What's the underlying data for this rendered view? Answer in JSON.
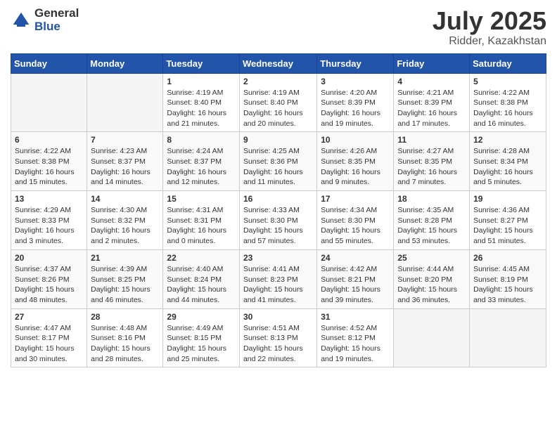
{
  "header": {
    "logo_general": "General",
    "logo_blue": "Blue",
    "title": "July 2025",
    "subtitle": "Ridder, Kazakhstan"
  },
  "weekdays": [
    "Sunday",
    "Monday",
    "Tuesday",
    "Wednesday",
    "Thursday",
    "Friday",
    "Saturday"
  ],
  "weeks": [
    [
      {
        "day": "",
        "info": ""
      },
      {
        "day": "",
        "info": ""
      },
      {
        "day": "1",
        "info": "Sunrise: 4:19 AM\nSunset: 8:40 PM\nDaylight: 16 hours\nand 21 minutes."
      },
      {
        "day": "2",
        "info": "Sunrise: 4:19 AM\nSunset: 8:40 PM\nDaylight: 16 hours\nand 20 minutes."
      },
      {
        "day": "3",
        "info": "Sunrise: 4:20 AM\nSunset: 8:39 PM\nDaylight: 16 hours\nand 19 minutes."
      },
      {
        "day": "4",
        "info": "Sunrise: 4:21 AM\nSunset: 8:39 PM\nDaylight: 16 hours\nand 17 minutes."
      },
      {
        "day": "5",
        "info": "Sunrise: 4:22 AM\nSunset: 8:38 PM\nDaylight: 16 hours\nand 16 minutes."
      }
    ],
    [
      {
        "day": "6",
        "info": "Sunrise: 4:22 AM\nSunset: 8:38 PM\nDaylight: 16 hours\nand 15 minutes."
      },
      {
        "day": "7",
        "info": "Sunrise: 4:23 AM\nSunset: 8:37 PM\nDaylight: 16 hours\nand 14 minutes."
      },
      {
        "day": "8",
        "info": "Sunrise: 4:24 AM\nSunset: 8:37 PM\nDaylight: 16 hours\nand 12 minutes."
      },
      {
        "day": "9",
        "info": "Sunrise: 4:25 AM\nSunset: 8:36 PM\nDaylight: 16 hours\nand 11 minutes."
      },
      {
        "day": "10",
        "info": "Sunrise: 4:26 AM\nSunset: 8:35 PM\nDaylight: 16 hours\nand 9 minutes."
      },
      {
        "day": "11",
        "info": "Sunrise: 4:27 AM\nSunset: 8:35 PM\nDaylight: 16 hours\nand 7 minutes."
      },
      {
        "day": "12",
        "info": "Sunrise: 4:28 AM\nSunset: 8:34 PM\nDaylight: 16 hours\nand 5 minutes."
      }
    ],
    [
      {
        "day": "13",
        "info": "Sunrise: 4:29 AM\nSunset: 8:33 PM\nDaylight: 16 hours\nand 3 minutes."
      },
      {
        "day": "14",
        "info": "Sunrise: 4:30 AM\nSunset: 8:32 PM\nDaylight: 16 hours\nand 2 minutes."
      },
      {
        "day": "15",
        "info": "Sunrise: 4:31 AM\nSunset: 8:31 PM\nDaylight: 16 hours\nand 0 minutes."
      },
      {
        "day": "16",
        "info": "Sunrise: 4:33 AM\nSunset: 8:30 PM\nDaylight: 15 hours\nand 57 minutes."
      },
      {
        "day": "17",
        "info": "Sunrise: 4:34 AM\nSunset: 8:30 PM\nDaylight: 15 hours\nand 55 minutes."
      },
      {
        "day": "18",
        "info": "Sunrise: 4:35 AM\nSunset: 8:28 PM\nDaylight: 15 hours\nand 53 minutes."
      },
      {
        "day": "19",
        "info": "Sunrise: 4:36 AM\nSunset: 8:27 PM\nDaylight: 15 hours\nand 51 minutes."
      }
    ],
    [
      {
        "day": "20",
        "info": "Sunrise: 4:37 AM\nSunset: 8:26 PM\nDaylight: 15 hours\nand 48 minutes."
      },
      {
        "day": "21",
        "info": "Sunrise: 4:39 AM\nSunset: 8:25 PM\nDaylight: 15 hours\nand 46 minutes."
      },
      {
        "day": "22",
        "info": "Sunrise: 4:40 AM\nSunset: 8:24 PM\nDaylight: 15 hours\nand 44 minutes."
      },
      {
        "day": "23",
        "info": "Sunrise: 4:41 AM\nSunset: 8:23 PM\nDaylight: 15 hours\nand 41 minutes."
      },
      {
        "day": "24",
        "info": "Sunrise: 4:42 AM\nSunset: 8:21 PM\nDaylight: 15 hours\nand 39 minutes."
      },
      {
        "day": "25",
        "info": "Sunrise: 4:44 AM\nSunset: 8:20 PM\nDaylight: 15 hours\nand 36 minutes."
      },
      {
        "day": "26",
        "info": "Sunrise: 4:45 AM\nSunset: 8:19 PM\nDaylight: 15 hours\nand 33 minutes."
      }
    ],
    [
      {
        "day": "27",
        "info": "Sunrise: 4:47 AM\nSunset: 8:17 PM\nDaylight: 15 hours\nand 30 minutes."
      },
      {
        "day": "28",
        "info": "Sunrise: 4:48 AM\nSunset: 8:16 PM\nDaylight: 15 hours\nand 28 minutes."
      },
      {
        "day": "29",
        "info": "Sunrise: 4:49 AM\nSunset: 8:15 PM\nDaylight: 15 hours\nand 25 minutes."
      },
      {
        "day": "30",
        "info": "Sunrise: 4:51 AM\nSunset: 8:13 PM\nDaylight: 15 hours\nand 22 minutes."
      },
      {
        "day": "31",
        "info": "Sunrise: 4:52 AM\nSunset: 8:12 PM\nDaylight: 15 hours\nand 19 minutes."
      },
      {
        "day": "",
        "info": ""
      },
      {
        "day": "",
        "info": ""
      }
    ]
  ]
}
